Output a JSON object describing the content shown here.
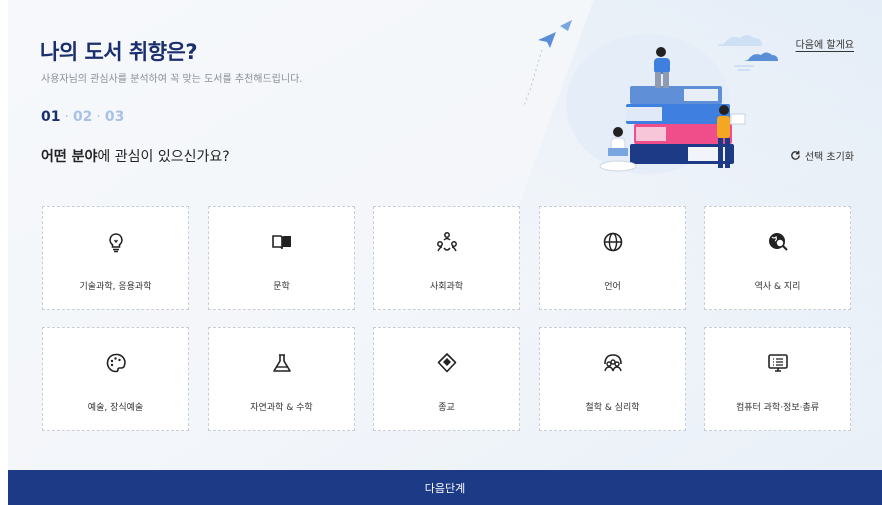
{
  "header": {
    "title": "나의 도서 취향은?",
    "subtitle": "사용자님의 관심사를 분석하여 꼭 맞는 도서를 추천해드립니다.",
    "later_label": "다음에 할게요"
  },
  "steps": {
    "step1": "01",
    "step2": "02",
    "step3": "03",
    "active_step": 1
  },
  "question": {
    "bold": "어떤 분야",
    "rest": "에 관심이 있으신가요?"
  },
  "reset_label": "선택 초기화",
  "categories": [
    {
      "label": "기술과학, 응용과학",
      "icon": "lightbulb-icon"
    },
    {
      "label": "문학",
      "icon": "open-book-icon"
    },
    {
      "label": "사회과학",
      "icon": "people-network-icon"
    },
    {
      "label": "언어",
      "icon": "globe-icon"
    },
    {
      "label": "역사 & 지리",
      "icon": "globe-search-icon"
    },
    {
      "label": "예술, 장식예술",
      "icon": "palette-icon"
    },
    {
      "label": "자연과학 & 수학",
      "icon": "flask-icon"
    },
    {
      "label": "종교",
      "icon": "praying-hands-icon"
    },
    {
      "label": "철학 & 심리학",
      "icon": "group-heads-icon"
    },
    {
      "label": "컴퓨터 과학·정보·총류",
      "icon": "monitor-list-icon"
    }
  ],
  "next_label": "다음단계",
  "colors": {
    "primary": "#1c3a86",
    "title": "#1b2f6e",
    "step_inactive": "#a8c2e6"
  }
}
